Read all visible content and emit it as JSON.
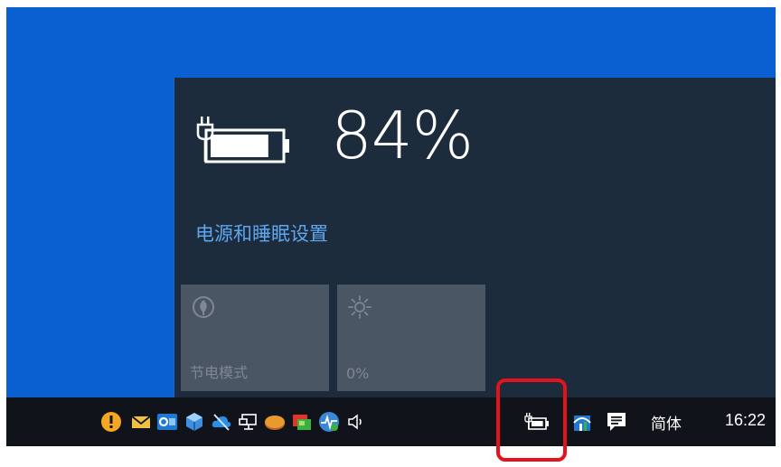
{
  "battery_flyout": {
    "percent_label": "84%",
    "battery_level": 0.84,
    "settings_link": "电源和睡眠设置",
    "tiles": [
      {
        "icon": "battery-saver-icon",
        "label": "节电模式"
      },
      {
        "icon": "brightness-icon",
        "label": "0%"
      }
    ]
  },
  "taskbar": {
    "tray_icons": [
      "security-alert-icon",
      "mail-icon",
      "outlook-icon",
      "cube-app-icon",
      "cloud-sync-icon",
      "network-icon",
      "disk-app-icon",
      "photo-app-icon",
      "monitor-app-icon",
      "volume-icon",
      "battery-charging-icon",
      "remote-app-icon",
      "action-center-icon"
    ],
    "input_language": "简体",
    "clock": "16:22"
  },
  "colors": {
    "desktop": "#0a5fd1",
    "flyout_background": "#1d2c3d",
    "link": "#5ea6ee",
    "tile_background": "#4a5663",
    "taskbar": "#101319",
    "highlight": "#e4121d"
  }
}
